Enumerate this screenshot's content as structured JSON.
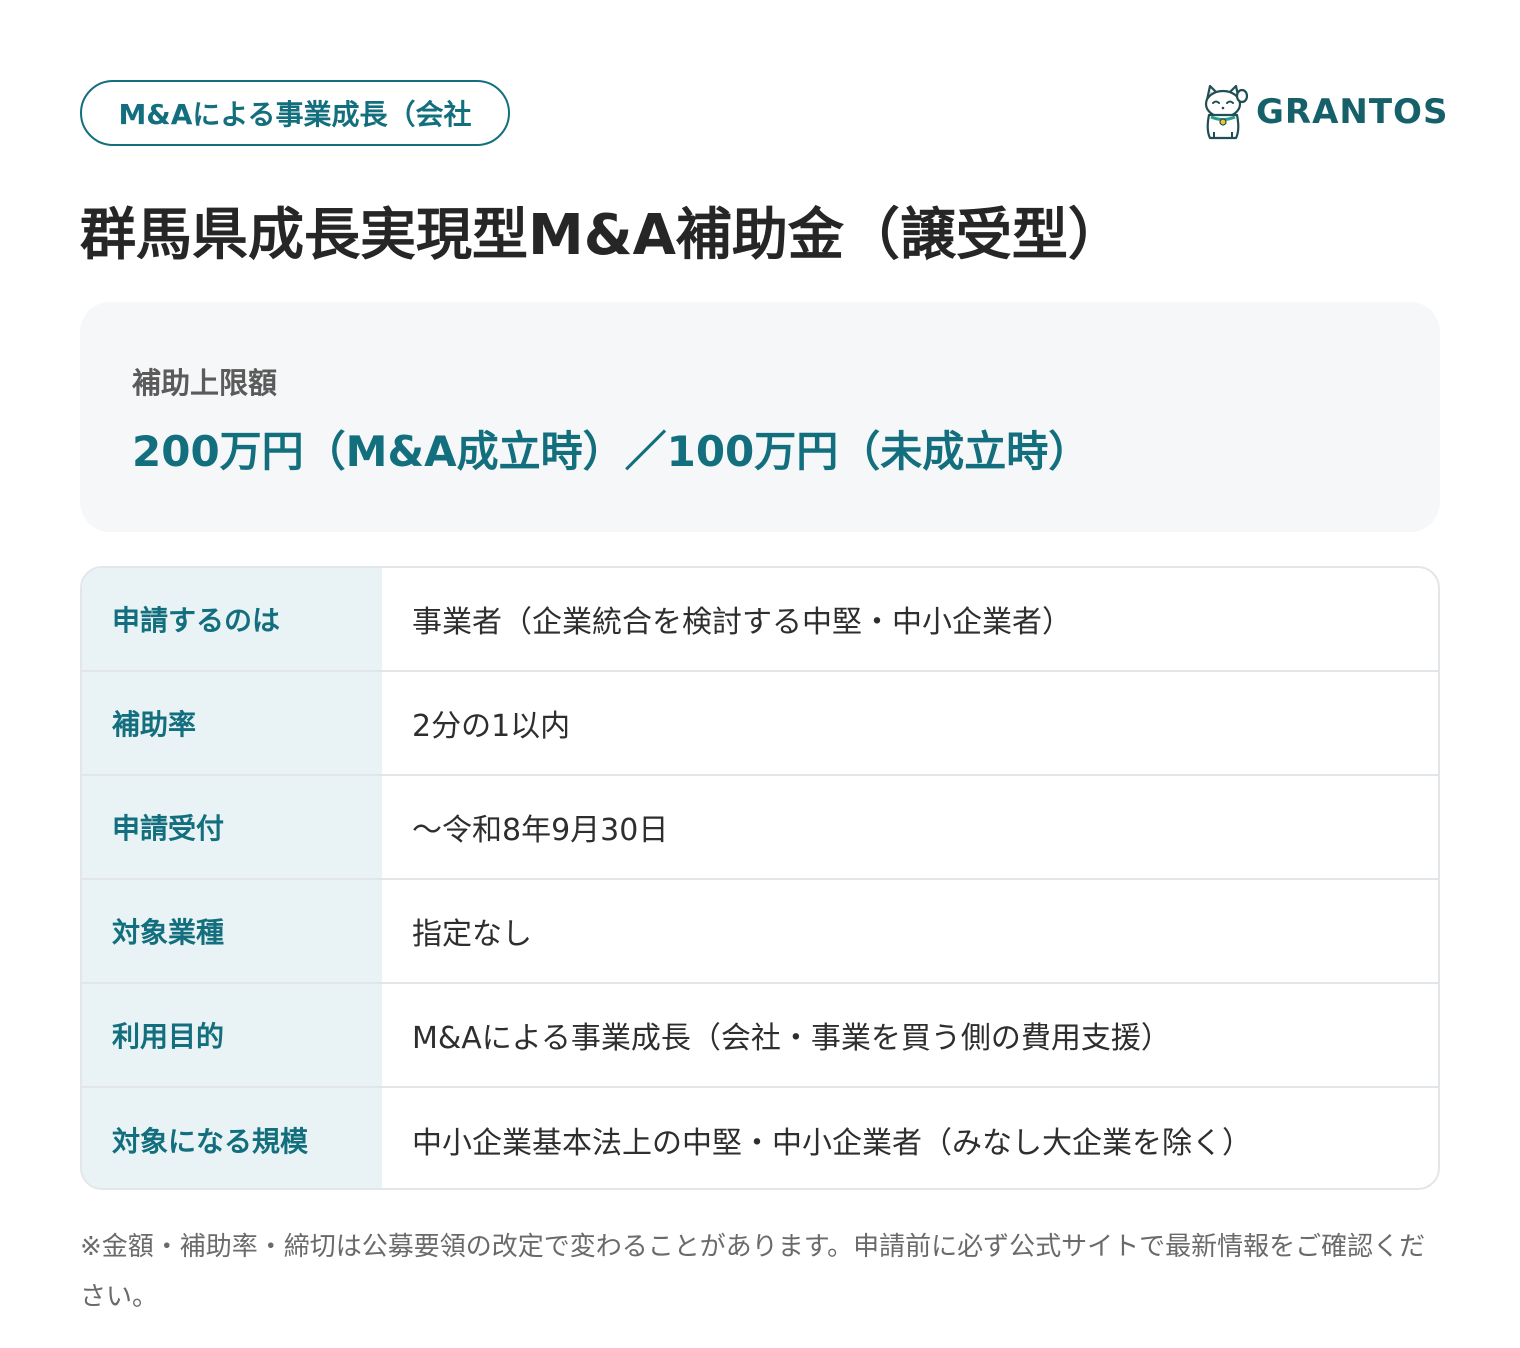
{
  "tag": {
    "label": "M&Aによる事業成長（会社"
  },
  "brand": {
    "name": "GRANTOS",
    "icon": "maneki-neko-cat-icon"
  },
  "title": "群馬県成長実現型M&A補助金（譲受型）",
  "limit": {
    "label": "補助上限額",
    "value": "200万円（M&A成立時）／100万円（未成立時）"
  },
  "rows": [
    {
      "label": "申請するのは",
      "value": "事業者（企業統合を検討する中堅・中小企業者）"
    },
    {
      "label": "補助率",
      "value": "2分の1以内"
    },
    {
      "label": "申請受付",
      "value": "〜令和8年9月30日"
    },
    {
      "label": "対象業種",
      "value": "指定なし"
    },
    {
      "label": "利用目的",
      "value": "M&Aによる事業成長（会社・事業を買う側の費用支援）"
    },
    {
      "label": "対象になる規模",
      "value": "中小企業基本法上の中堅・中小企業者（みなし大企業を除く）"
    }
  ],
  "note": "※金額・補助率・締切は公募要領の改定で変わることがあります。申請前に必ず公式サイトで最新情報をご確認ください。",
  "colors": {
    "accent": "#136f7e",
    "brand": "#16606a",
    "label_bg": "#e9f3f5",
    "box_bg": "#f5f7f8"
  }
}
